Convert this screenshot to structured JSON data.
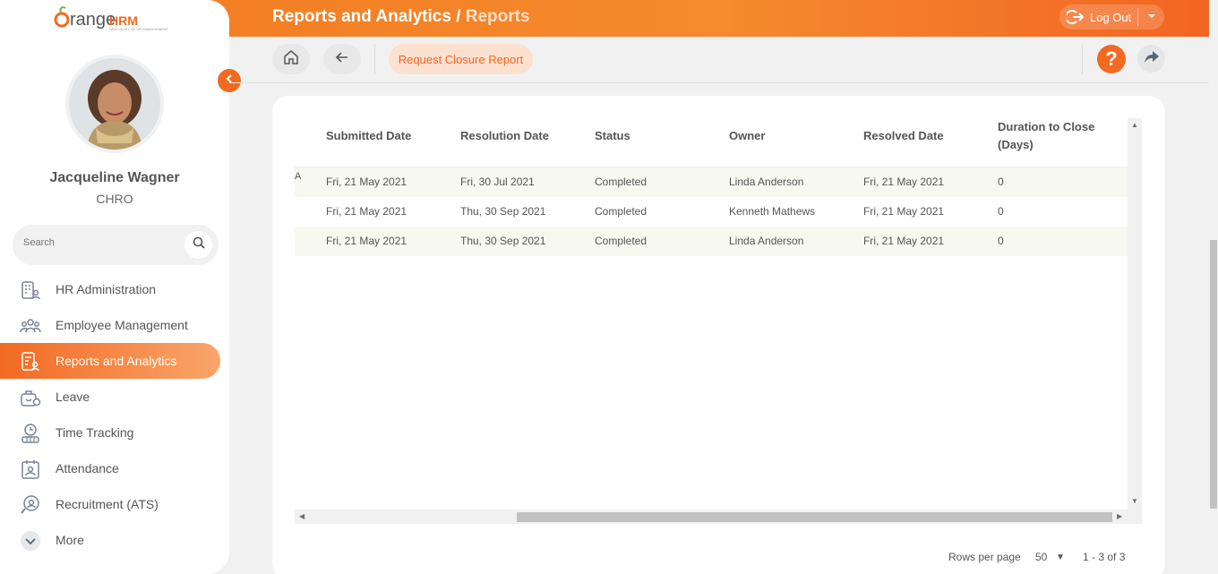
{
  "header": {
    "title": "Reports and Analytics",
    "separator": "/",
    "subtitle": "Reports",
    "logout_label": "Log Out"
  },
  "logo": {
    "brand_main": "range",
    "brand_accent": "HRM",
    "tagline": "NEW LEVEL OF HR MANAGEMENT"
  },
  "user": {
    "name": "Jacqueline Wagner",
    "role": "CHRO"
  },
  "search": {
    "placeholder": "Search"
  },
  "menu": {
    "items": [
      {
        "label": "HR Administration",
        "icon": "building-user-icon"
      },
      {
        "label": "Employee Management",
        "icon": "people-group-icon"
      },
      {
        "label": "Reports and Analytics",
        "icon": "report-user-icon",
        "active": true
      },
      {
        "label": "Leave",
        "icon": "leave-icon"
      },
      {
        "label": "Time Tracking",
        "icon": "clock-icon"
      },
      {
        "label": "Attendance",
        "icon": "attendance-icon"
      },
      {
        "label": "Recruitment (ATS)",
        "icon": "recruitment-icon"
      },
      {
        "label": "More",
        "icon": "chevron-down-icon"
      }
    ]
  },
  "toolbar": {
    "request_label": "Request Closure Report",
    "help_label": "?"
  },
  "table": {
    "columns": [
      "Submitted Date",
      "Resolution Date",
      "Status",
      "Owner",
      "Resolved Date",
      "Duration to Close (Days)"
    ],
    "rows": [
      [
        "Fri, 21 May 2021",
        "Fri, 30 Jul 2021",
        "Completed",
        "Linda Anderson",
        "Fri, 21 May 2021",
        "0"
      ],
      [
        "Fri, 21 May 2021",
        "Thu, 30 Sep 2021",
        "Completed",
        "Kenneth Mathews",
        "Fri, 21 May 2021",
        "0"
      ],
      [
        "Fri, 21 May 2021",
        "Thu, 30 Sep 2021",
        "Completed",
        "Linda Anderson",
        "Fri, 21 May 2021",
        "0"
      ]
    ],
    "clipped_edge": "A"
  },
  "pagination": {
    "rows_per_page_label": "Rows per page",
    "rows_per_page": "50",
    "range": "1 - 3 of 3"
  },
  "colors": {
    "accent": "#f26a22",
    "active_gradient_end": "#f9a56a"
  }
}
